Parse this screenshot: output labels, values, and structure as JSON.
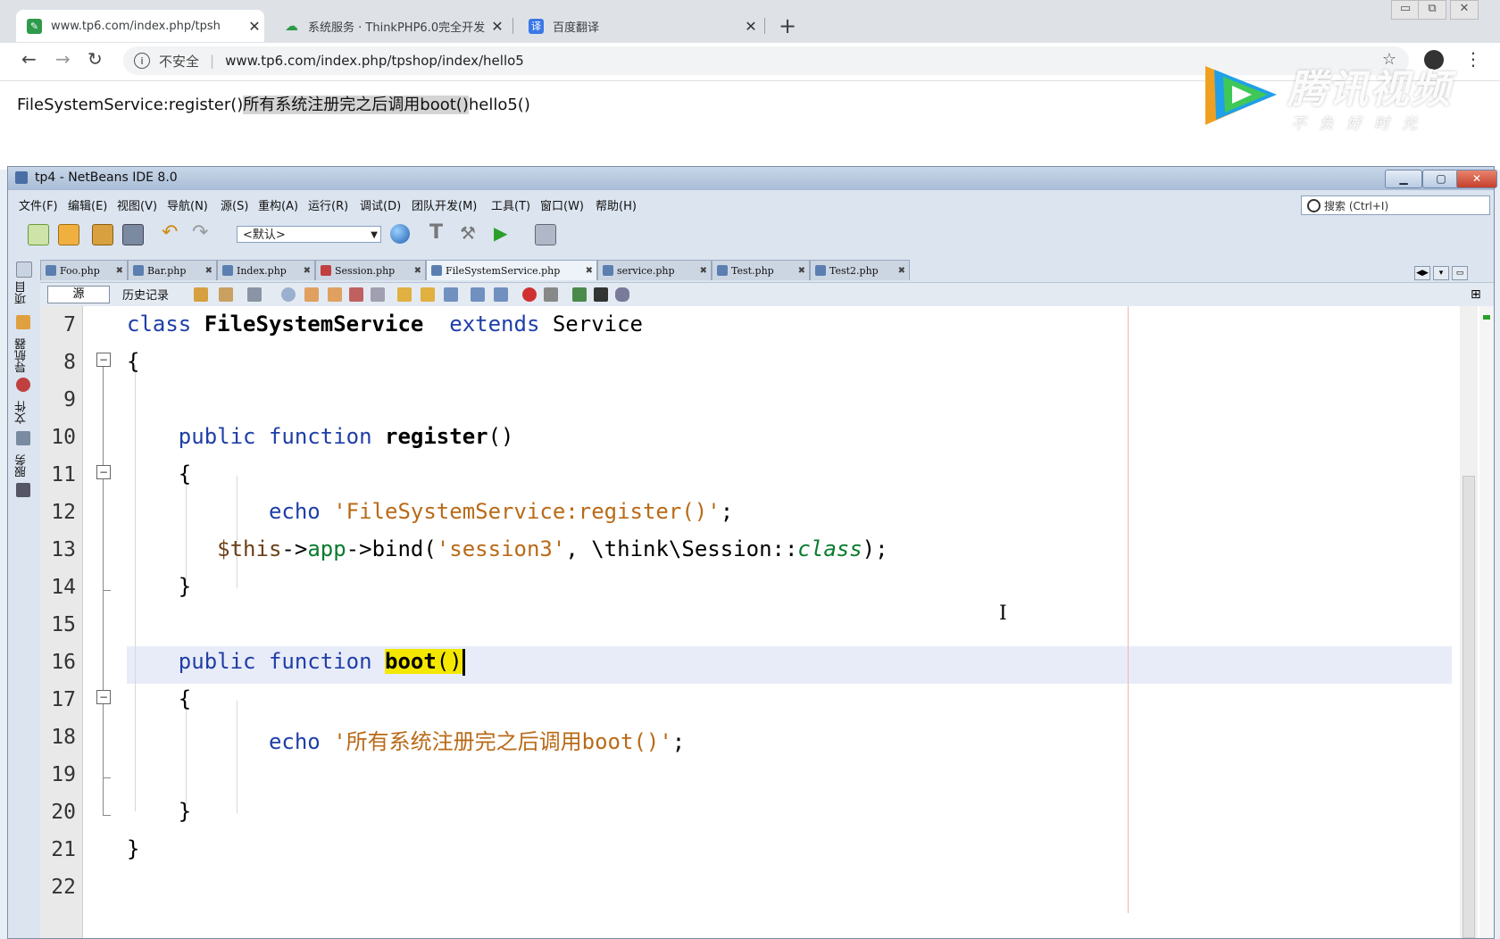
{
  "browser": {
    "tabs": [
      {
        "title": "www.tp6.com/index.php/tpsh",
        "favicon": "tp-leaf-icon",
        "active": true
      },
      {
        "title": "系统服务 · ThinkPHP6.0完全开发",
        "favicon": "kancloud-icon",
        "active": false
      },
      {
        "title": "百度翻译",
        "favicon": "baidu-translate-icon",
        "active": false
      }
    ],
    "security_label": "不安全",
    "url": "www.tp6.com/index.php/tpshop/index/hello5",
    "page_text": {
      "before": "FileSystemService:register()",
      "selected": "所有系统注册完之后调用boot()",
      "after": "hello5()"
    }
  },
  "watermark": {
    "brand": "腾讯视频",
    "slogan": "不负好时光"
  },
  "ide": {
    "title": "tp4 - NetBeans IDE 8.0",
    "menus": [
      "文件(F)",
      "编辑(E)",
      "视图(V)",
      "导航(N)",
      "源(S)",
      "重构(A)",
      "运行(R)",
      "调试(D)",
      "团队开发(M)",
      "工具(T)",
      "窗口(W)",
      "帮助(H)"
    ],
    "search_placeholder": "搜索 (Ctrl+I)",
    "config_value": "<默认>",
    "side_panels": [
      "项目",
      "导航器",
      "文件",
      "服务"
    ],
    "file_tabs": [
      "Foo.php",
      "Bar.php",
      "Index.php",
      "Session.php",
      "FileSystemService.php",
      "service.php",
      "Test.php",
      "Test2.php"
    ],
    "active_tab": "FileSystemService.php",
    "source_button": "源",
    "history_button": "历史记录",
    "line_numbers": [
      "7",
      "8",
      "9",
      "10",
      "11",
      "12",
      "13",
      "14",
      "15",
      "16",
      "17",
      "18",
      "19",
      "20",
      "21",
      "22"
    ],
    "code": {
      "l7": {
        "kw1": "class",
        "name": "FileSystemService",
        "kw2": "extends",
        "parent": "Service"
      },
      "l8": "{",
      "l10": {
        "kw1": "public",
        "kw2": "function",
        "name": "register",
        "parens": "()"
      },
      "l11": "{",
      "l12": {
        "kw": "echo",
        "str": "'FileSystemService:register()'",
        "semi": ";"
      },
      "l13": {
        "var": "$this",
        "arrow1": "->",
        "prop": "app",
        "arrow2": "->",
        "method": "bind(",
        "str": "'session3'",
        "mid": ", \\think\\Session::",
        "cls": "class",
        "end": ");"
      },
      "l14": "}",
      "l16": {
        "kw1": "public",
        "kw2": "function",
        "name": "boot",
        "parens": "()"
      },
      "l17": "{",
      "l18": {
        "kw": "echo",
        "str": "'所有系统注册完之后调用boot()'",
        "semi": ";"
      },
      "l20": "}",
      "l21": "}"
    }
  }
}
